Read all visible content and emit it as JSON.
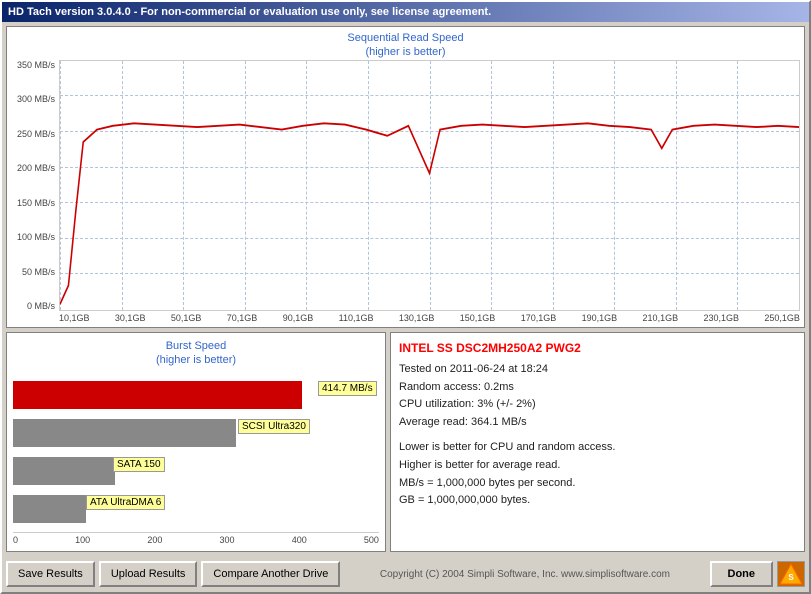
{
  "titleBar": {
    "text": "HD Tach version 3.0.4.0  - For non-commercial or evaluation use only, see license agreement."
  },
  "seqChart": {
    "title1": "Sequential Read Speed",
    "title2": "(higher is better)",
    "yAxis": [
      "0 MB/s",
      "50 MB/s",
      "100 MB/s",
      "150 MB/s",
      "200 MB/s",
      "250 MB/s",
      "300 MB/s",
      "350 MB/s"
    ],
    "xAxis": [
      "10,1GB",
      "30,1GB",
      "50,1GB",
      "70,1GB",
      "90,1GB",
      "110,1GB",
      "130,1GB",
      "150,1GB",
      "170,1GB",
      "190,1GB",
      "210,1GB",
      "230,1GB",
      "250,1GB"
    ]
  },
  "burstChart": {
    "title1": "Burst Speed",
    "title2": "(higher is better)",
    "bars": [
      {
        "label": "414.7 MB/s",
        "color": "#cc0000",
        "widthPct": 79,
        "labelLeft": 315
      },
      {
        "label": "SCSI Ultra320",
        "color": "#888888",
        "widthPct": 61,
        "labelLeft": 235
      },
      {
        "label": "SATA 150",
        "color": "#888888",
        "widthPct": 28,
        "labelLeft": 110
      },
      {
        "label": "ATA UltraDMA 6",
        "color": "#888888",
        "widthPct": 20,
        "labelLeft": 80
      }
    ],
    "xAxisLabels": [
      "0",
      "100",
      "200",
      "300",
      "400",
      "500"
    ]
  },
  "infoPanel": {
    "driveName": "INTEL SS DSC2MH250A2 PWG2",
    "stats": "Tested on 2011-06-24 at 18:24\nRandom access: 0.2ms\nCPU utilization: 3% (+/- 2%)\nAverage read: 364.1 MB/s",
    "notes": "Lower is better for CPU and random access.\nHigher is better for average read.\nMB/s = 1,000,000 bytes per second.\nGB = 1,000,000,000 bytes."
  },
  "footer": {
    "saveBtn": "Save Results",
    "uploadBtn": "Upload Results",
    "compareBtn": "Compare Another Drive",
    "copyright": "Copyright (C) 2004 Simpli Software, Inc. www.simplisoftware.com",
    "doneBtn": "Done"
  }
}
